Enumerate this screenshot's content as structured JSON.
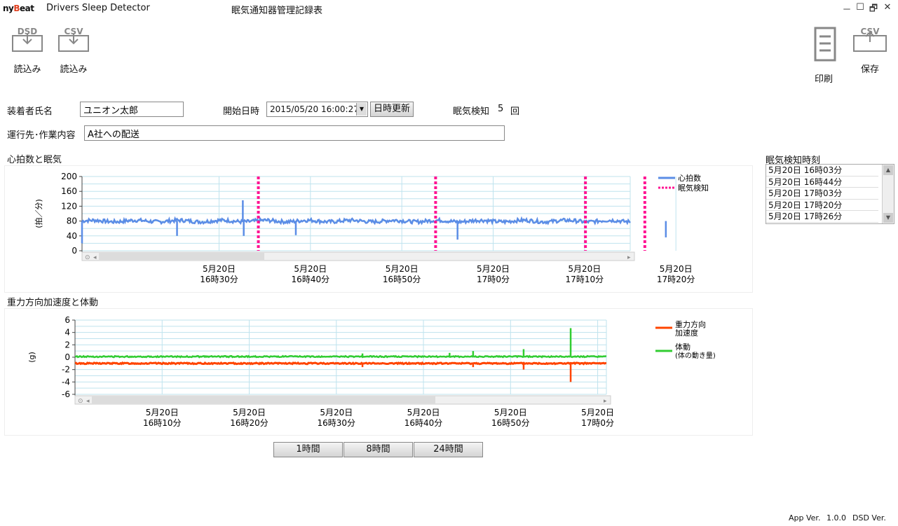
{
  "app": {
    "brand_prefix": "ny",
    "brand_b": "B",
    "brand_suffix": "eat",
    "title": "Drivers Sleep Detector",
    "doc_title": "眠気通知器管理記録表",
    "win_min": "－",
    "win_max": "☐",
    "win_restore": "🗗",
    "win_close": "✕"
  },
  "toolbar": {
    "dsd_cap": "DSD",
    "dsd_label": "読込み",
    "csv_cap": "CSV",
    "csv_label": "読込み",
    "print_label": "印刷",
    "save_cap": "CSV",
    "save_label": "保存"
  },
  "form": {
    "wearer_label": "装着者氏名",
    "wearer_value": "ユニオン太郎",
    "start_label": "開始日時",
    "start_value": "2015/05/20 16:00:27",
    "update_button": "日時更新",
    "sleep_label": "眠気検知",
    "sleep_count": "5",
    "sleep_unit": "回",
    "dest_label": "運行先･作業内容",
    "dest_value": "A社への配送"
  },
  "detect_list": {
    "title": "眠気検知時刻",
    "items": [
      "5月20日 16時03分",
      "5月20日 16時44分",
      "5月20日 17時03分",
      "5月20日 17時20分",
      "5月20日 17時26分"
    ]
  },
  "chart1_section": "心拍数と眠気",
  "chart2_section": "重力方向加速度と体動",
  "range_buttons": [
    "1時間",
    "8時間",
    "24時間"
  ],
  "footer": {
    "app_ver": "App Ver.",
    "app_ver_value": "1.0.0",
    "dsd_ver": "DSD Ver."
  },
  "chart_data": [
    {
      "type": "line",
      "title": "心拍数と眠気",
      "ylabel": "(拍／分)",
      "ylim": [
        0,
        200
      ],
      "yticks": [
        "0",
        "40",
        "80",
        "120",
        "160",
        "200"
      ],
      "x_ticks": [
        [
          "5月20日",
          "16時30分"
        ],
        [
          "5月20日",
          "16時40分"
        ],
        [
          "5月20日",
          "16時50分"
        ],
        [
          "5月20日",
          "17時0分"
        ],
        [
          "5月20日",
          "17時10分"
        ],
        [
          "5月20日",
          "17時20分"
        ]
      ],
      "x_range_min": [
        -15,
        45
      ],
      "x_tick_values": [
        0,
        10,
        20,
        30,
        40,
        50
      ],
      "legend": [
        "心拍数",
        "眠気検知"
      ],
      "legend_position": "right",
      "colors": {
        "heart": "#5b8de6",
        "sleep": "#ff1493"
      },
      "heart_baseline": 80,
      "heart_spikes": [
        [
          -15,
          20
        ],
        [
          -4.6,
          40
        ],
        [
          2.6,
          136
        ],
        [
          2.7,
          40
        ],
        [
          8.4,
          42
        ],
        [
          26.1,
          30
        ],
        [
          48.9,
          36
        ],
        [
          59,
          60
        ]
      ],
      "sleep_events_min": [
        4.3,
        23.7,
        40.1,
        46.6
      ]
    },
    {
      "type": "line",
      "title": "重力方向加速度と体動",
      "ylabel": "(g)",
      "ylim": [
        -6,
        6
      ],
      "yticks": [
        "-6",
        "-4",
        "-2",
        "0",
        "2",
        "4",
        "6"
      ],
      "x_ticks": [
        [
          "5月20日",
          "16時10分"
        ],
        [
          "5月20日",
          "16時20分"
        ],
        [
          "5月20日",
          "16時30分"
        ],
        [
          "5月20日",
          "16時40分"
        ],
        [
          "5月20日",
          "16時50分"
        ],
        [
          "5月20日",
          "17時0分"
        ]
      ],
      "x_range_min": [
        0,
        61
      ],
      "x_tick_values": [
        10,
        20,
        30,
        40,
        50,
        60
      ],
      "legend": [
        "重力方向\n加速度",
        "体動\n(体の動き量)"
      ],
      "legend_position": "right",
      "colors": {
        "gravity": "#ff4500",
        "motion": "#32cd32"
      },
      "gravity_baseline": -1,
      "motion_baseline": 0,
      "gravity_spikes": [
        [
          33,
          -1.6
        ],
        [
          45.7,
          -1.6
        ],
        [
          51.5,
          -2.0
        ],
        [
          56.9,
          -4.0
        ]
      ],
      "motion_spikes": [
        [
          33,
          0.6
        ],
        [
          43,
          0.7
        ],
        [
          45.7,
          1.0
        ],
        [
          51.5,
          1.3
        ],
        [
          56.9,
          4.7
        ]
      ]
    }
  ]
}
